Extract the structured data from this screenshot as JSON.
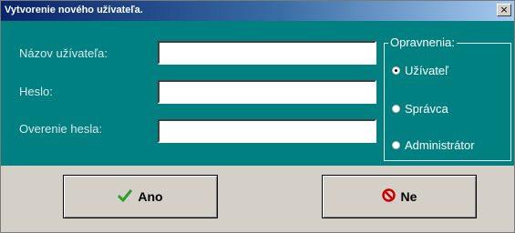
{
  "window": {
    "title": "Vytvorenie nového užívateľa.",
    "close_glyph": "×"
  },
  "form": {
    "username_label": "Názov užívateľa:",
    "password_label": "Heslo:",
    "confirm_label": "Overenie hesla:",
    "username_value": "",
    "password_value": "",
    "confirm_value": ""
  },
  "permissions": {
    "title": "Opravnenia:",
    "options": [
      {
        "label": "Užívateľ",
        "checked": true
      },
      {
        "label": "Správca",
        "checked": false
      },
      {
        "label": "Administrátor",
        "checked": false
      }
    ]
  },
  "buttons": {
    "yes_label": "Ano",
    "no_label": "Ne"
  },
  "colors": {
    "panel": "#008080",
    "yes_icon": "#2aa02a",
    "no_icon": "#cc0000"
  },
  "icons": {
    "yes": "checkmark-icon",
    "no": "prohibited-icon"
  }
}
